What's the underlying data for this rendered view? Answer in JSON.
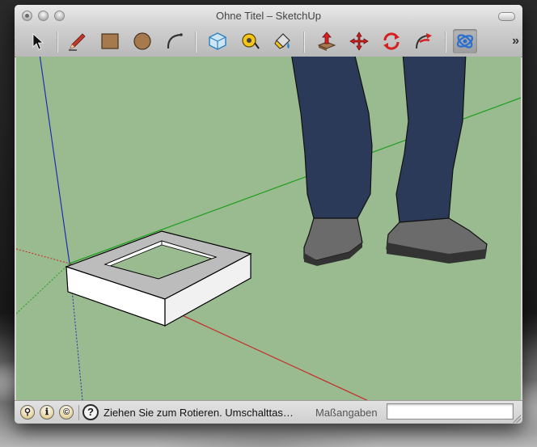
{
  "window": {
    "title": "Ohne Titel – SketchUp"
  },
  "toolbar": {
    "tools": [
      {
        "name": "select",
        "icon": "arrow-cursor-icon",
        "active": false
      },
      {
        "name": "pencil",
        "icon": "pencil-icon",
        "active": false
      },
      {
        "name": "rectangle",
        "icon": "rectangle-icon",
        "active": false
      },
      {
        "name": "circle",
        "icon": "circle-icon",
        "active": false
      },
      {
        "name": "arc",
        "icon": "arc-icon",
        "active": false
      },
      {
        "name": "make-component",
        "icon": "component-icon",
        "active": false
      },
      {
        "name": "tape-measure",
        "icon": "tape-measure-icon",
        "active": false
      },
      {
        "name": "paint-bucket",
        "icon": "paint-bucket-icon",
        "active": false
      },
      {
        "name": "push-pull",
        "icon": "push-pull-icon",
        "active": false
      },
      {
        "name": "move",
        "icon": "move-icon",
        "active": false
      },
      {
        "name": "rotate",
        "icon": "rotate-icon",
        "active": false
      },
      {
        "name": "follow-me",
        "icon": "follow-me-icon",
        "active": false
      },
      {
        "name": "orbit",
        "icon": "orbit-icon",
        "active": true
      }
    ],
    "overflow_label": "»"
  },
  "statusbar": {
    "info_icons": [
      "geo-location-icon",
      "credits-icon",
      "license-icon"
    ],
    "help_label": "?",
    "status_text": "Ziehen Sie zum Rotieren.  Umschalttas…",
    "measurements_label": "Maßangaben",
    "measurements_value": ""
  },
  "colors": {
    "viewport_background": "#99bb8f",
    "axis_red": "#c62828",
    "axis_green": "#1e9e1e",
    "axis_blue": "#1f2fb0",
    "jeans": "#2c3a5a",
    "shoes": "#6b6b6b"
  }
}
